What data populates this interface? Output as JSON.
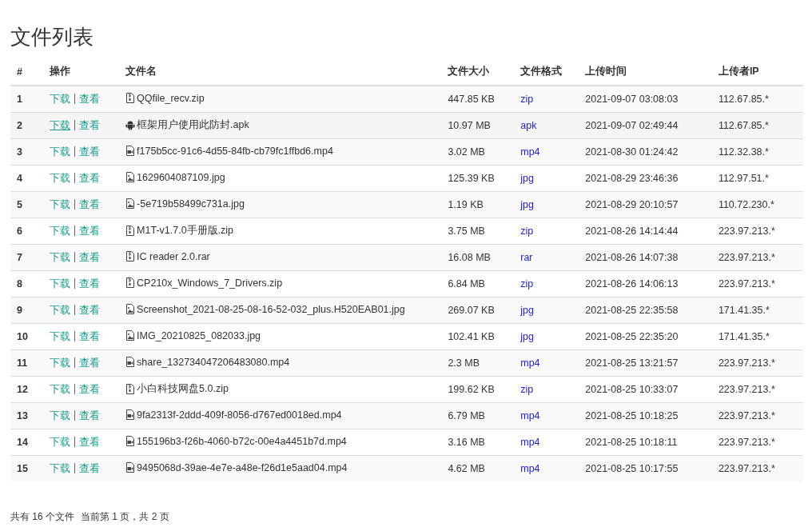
{
  "title": "文件列表",
  "table": {
    "columns": [
      "#",
      "操作",
      "文件名",
      "文件大小",
      "文件格式",
      "上传时间",
      "上传者IP"
    ],
    "rows": [
      {
        "index": "1",
        "actions": [
          "下载",
          "查看"
        ],
        "kind": "archive",
        "name": "QQfile_recv.zip",
        "size": "447.85 KB",
        "format": "zip",
        "time": "2021-09-07 03:08:03",
        "ip": "112.67.85.*",
        "hovered": false
      },
      {
        "index": "2",
        "actions": [
          "下载",
          "查看"
        ],
        "kind": "android",
        "name": "框架用户使用此防封.apk",
        "size": "10.97 MB",
        "format": "apk",
        "time": "2021-09-07 02:49:44",
        "ip": "112.67.85.*",
        "hovered": true
      },
      {
        "index": "3",
        "actions": [
          "下载",
          "查看"
        ],
        "kind": "video",
        "name": "f175b5cc-91c6-4d55-84fb-cb79fc1ffbd6.mp4",
        "size": "3.02 MB",
        "format": "mp4",
        "time": "2021-08-30 01:24:42",
        "ip": "112.32.38.*",
        "hovered": false
      },
      {
        "index": "4",
        "actions": [
          "下载",
          "查看"
        ],
        "kind": "image",
        "name": "1629604087109.jpg",
        "size": "125.39 KB",
        "format": "jpg",
        "time": "2021-08-29 23:46:36",
        "ip": "112.97.51.*",
        "hovered": false
      },
      {
        "index": "5",
        "actions": [
          "下载",
          "查看"
        ],
        "kind": "image",
        "name": "-5e719b58499c731a.jpg",
        "size": "1.19 KB",
        "format": "jpg",
        "time": "2021-08-29 20:10:57",
        "ip": "110.72.230.*",
        "hovered": false
      },
      {
        "index": "6",
        "actions": [
          "下载",
          "查看"
        ],
        "kind": "archive",
        "name": "M1T-v1.7.0手册版.zip",
        "size": "3.75 MB",
        "format": "zip",
        "time": "2021-08-26 14:14:44",
        "ip": "223.97.213.*",
        "hovered": false
      },
      {
        "index": "7",
        "actions": [
          "下载",
          "查看"
        ],
        "kind": "archive",
        "name": "IC reader 2.0.rar",
        "size": "16.08 MB",
        "format": "rar",
        "time": "2021-08-26 14:07:38",
        "ip": "223.97.213.*",
        "hovered": false
      },
      {
        "index": "8",
        "actions": [
          "下载",
          "查看"
        ],
        "kind": "archive",
        "name": "CP210x_Windows_7_Drivers.zip",
        "size": "6.84 MB",
        "format": "zip",
        "time": "2021-08-26 14:06:13",
        "ip": "223.97.213.*",
        "hovered": false
      },
      {
        "index": "9",
        "actions": [
          "下载",
          "查看"
        ],
        "kind": "image",
        "name": "Screenshot_2021-08-25-08-16-52-032_plus.H520EAB01.jpg",
        "size": "269.07 KB",
        "format": "jpg",
        "time": "2021-08-25 22:35:58",
        "ip": "171.41.35.*",
        "hovered": false
      },
      {
        "index": "10",
        "actions": [
          "下载",
          "查看"
        ],
        "kind": "image",
        "name": "IMG_20210825_082033.jpg",
        "size": "102.41 KB",
        "format": "jpg",
        "time": "2021-08-25 22:35:20",
        "ip": "171.41.35.*",
        "hovered": false
      },
      {
        "index": "11",
        "actions": [
          "下载",
          "查看"
        ],
        "kind": "video",
        "name": "share_132734047206483080.mp4",
        "size": "2.3 MB",
        "format": "mp4",
        "time": "2021-08-25 13:21:57",
        "ip": "223.97.213.*",
        "hovered": false
      },
      {
        "index": "12",
        "actions": [
          "下载",
          "查看"
        ],
        "kind": "archive",
        "name": "小白科技网盘5.0.zip",
        "size": "199.62 KB",
        "format": "zip",
        "time": "2021-08-25 10:33:07",
        "ip": "223.97.213.*",
        "hovered": false
      },
      {
        "index": "13",
        "actions": [
          "下载",
          "查看"
        ],
        "kind": "video",
        "name": "9fa2313f-2ddd-409f-8056-d767ed0018ed.mp4",
        "size": "6.79 MB",
        "format": "mp4",
        "time": "2021-08-25 10:18:25",
        "ip": "223.97.213.*",
        "hovered": false
      },
      {
        "index": "14",
        "actions": [
          "下载",
          "查看"
        ],
        "kind": "video",
        "name": "155196b3-f26b-4060-b72c-00e4a4451b7d.mp4",
        "size": "3.16 MB",
        "format": "mp4",
        "time": "2021-08-25 10:18:11",
        "ip": "223.97.213.*",
        "hovered": false
      },
      {
        "index": "15",
        "actions": [
          "下载",
          "查看"
        ],
        "kind": "video",
        "name": "9495068d-39ae-4e7e-a48e-f26d1e5aad04.mp4",
        "size": "4.62 MB",
        "format": "mp4",
        "time": "2021-08-25 10:17:55",
        "ip": "223.97.213.*",
        "hovered": false
      }
    ]
  },
  "footer": {
    "summary": "共有 16 个文件",
    "page": "当前第 1 页，共 2 页"
  }
}
